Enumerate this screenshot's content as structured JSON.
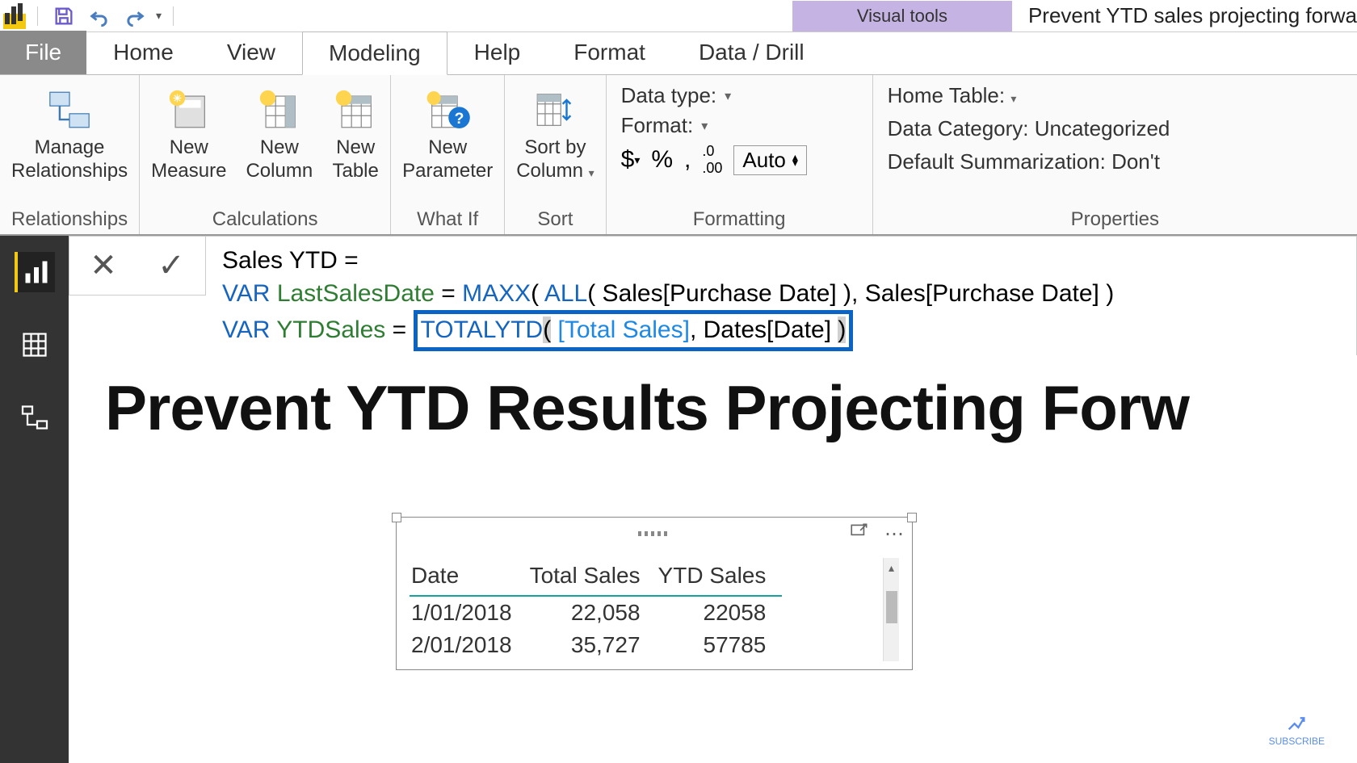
{
  "titlebar": {
    "visual_tools": "Visual tools",
    "window_title": "Prevent YTD sales projecting forwa"
  },
  "tabs": {
    "file": "File",
    "home": "Home",
    "view": "View",
    "modeling": "Modeling",
    "help": "Help",
    "format": "Format",
    "data_drill": "Data / Drill"
  },
  "ribbon": {
    "relationships": {
      "manage": "Manage\nRelationships",
      "group": "Relationships"
    },
    "calculations": {
      "measure": "New\nMeasure",
      "column": "New\nColumn",
      "table": "New\nTable",
      "group": "Calculations"
    },
    "whatif": {
      "parameter": "New\nParameter",
      "group": "What If"
    },
    "sort": {
      "sortby": "Sort by\nColumn",
      "group": "Sort"
    },
    "formatting": {
      "datatype_label": "Data type:",
      "format_label": "Format:",
      "auto": "Auto",
      "group": "Formatting"
    },
    "properties": {
      "home_table": "Home Table:",
      "data_category": "Data Category: Uncategorized",
      "default_sum": "Default Summarization: Don't",
      "group": "Properties"
    }
  },
  "formula": {
    "line1_prefix": "Sales YTD = ",
    "line2": {
      "var": "VAR",
      "name": "LastSalesDate",
      "eq": " = ",
      "fn1": "MAXX",
      "paren1": "( ",
      "fn2": "ALL",
      "inner": "( Sales[Purchase Date] ), Sales[Purchase Date] )"
    },
    "line3": {
      "var": "VAR",
      "name": "YTDSales",
      "eq": " = ",
      "fn": "TOTALYTD",
      "p_open": "(",
      "meas": " [Total Sales]",
      "rest": ", Dates[Date] ",
      "p_close": ")"
    }
  },
  "report": {
    "title": "Prevent YTD Results Projecting Forw"
  },
  "table": {
    "headers": [
      "Date",
      "Total Sales",
      "YTD Sales"
    ],
    "rows": [
      {
        "date": "1/01/2018",
        "total": "22,058",
        "ytd": "22058"
      },
      {
        "date": "2/01/2018",
        "total": "35,727",
        "ytd": "57785"
      }
    ]
  },
  "subscribe": "SUBSCRIBE"
}
